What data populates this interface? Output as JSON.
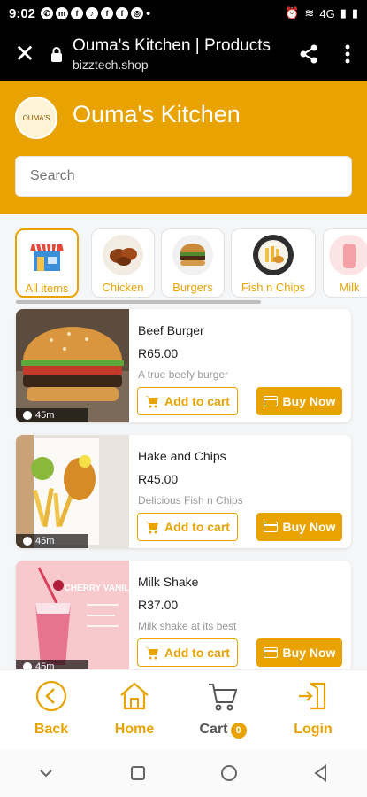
{
  "statusbar": {
    "time": "9:02",
    "dot": "•",
    "signal": "4G"
  },
  "browser": {
    "close": "✕",
    "title": "Ouma's Kitchen | Products",
    "url": "bizztech.shop"
  },
  "header": {
    "brand": "Ouma's Kitchen",
    "logo_text": "OUMA'S",
    "search_placeholder": "Search"
  },
  "categories": [
    {
      "label": "All items",
      "active": true
    },
    {
      "label": "Chicken"
    },
    {
      "label": "Burgers"
    },
    {
      "label": "Fish n Chips"
    },
    {
      "label": "Milk"
    }
  ],
  "products": [
    {
      "name": "Beef Burger",
      "price": "R65.00",
      "desc": "A true beefy burger",
      "time": "45m",
      "add": "Add to cart",
      "buy": "Buy Now"
    },
    {
      "name": "Hake and Chips",
      "price": "R45.00",
      "desc": "Delicious Fish n Chips",
      "time": "45m",
      "add": "Add to cart",
      "buy": "Buy Now"
    },
    {
      "name": "Milk Shake",
      "price": "R37.00",
      "desc": "Milk shake at its best",
      "time": "45m",
      "add": "Add to cart",
      "buy": "Buy Now",
      "img_text": "CHERRY VANILLA"
    }
  ],
  "nav": {
    "back": "Back",
    "home": "Home",
    "cart": "Cart",
    "cart_count": "0",
    "login": "Login"
  },
  "colors": {
    "accent": "#E8A300"
  },
  "icons": {
    "back": "chevron-left-circle-icon",
    "home": "home-icon",
    "cart": "cart-icon",
    "login": "login-icon"
  }
}
